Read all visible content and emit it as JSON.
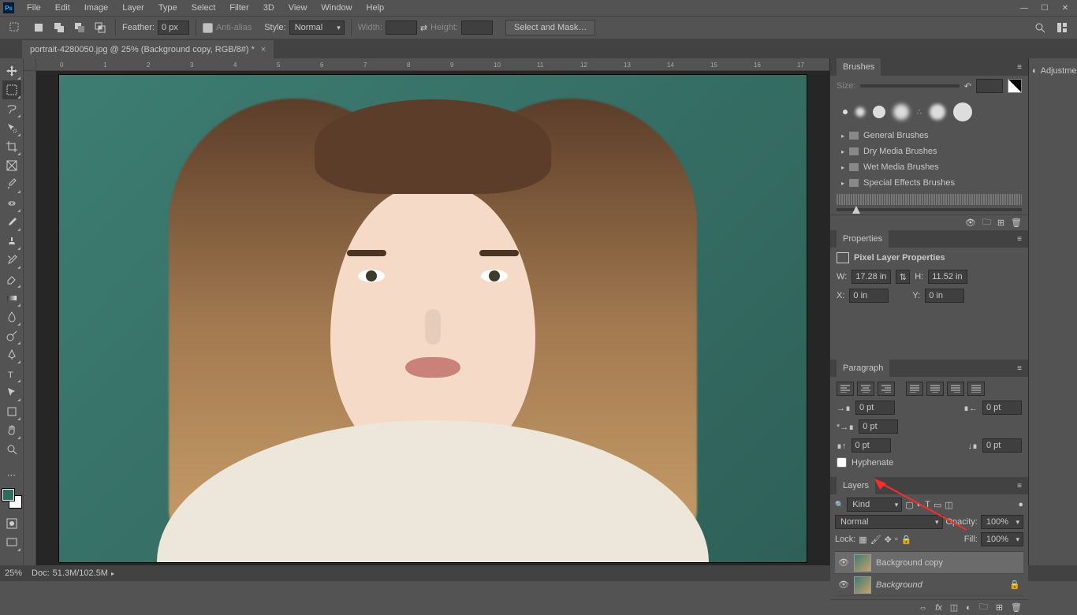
{
  "app": {
    "logo": "Ps"
  },
  "menu": [
    "File",
    "Edit",
    "Image",
    "Layer",
    "Type",
    "Select",
    "Filter",
    "3D",
    "View",
    "Window",
    "Help"
  ],
  "options": {
    "feather_label": "Feather:",
    "feather_value": "0 px",
    "antialias": "Anti-alias",
    "style_label": "Style:",
    "style_value": "Normal",
    "width_label": "Width:",
    "height_label": "Height:",
    "select_mask": "Select and Mask…"
  },
  "tab": {
    "title": "portrait-4280050.jpg @ 25% (Background copy, RGB/8#) *"
  },
  "ruler_marks": [
    "0",
    "1",
    "2",
    "3",
    "4",
    "5",
    "6",
    "7",
    "8",
    "9",
    "10",
    "11",
    "12",
    "13",
    "14",
    "15",
    "16",
    "17"
  ],
  "side_panel": {
    "adjustments": "Adjustments"
  },
  "brushes": {
    "title": "Brushes",
    "size_label": "Size:",
    "folders": [
      "General Brushes",
      "Dry Media Brushes",
      "Wet Media Brushes",
      "Special Effects Brushes"
    ]
  },
  "properties": {
    "title": "Properties",
    "subtitle": "Pixel Layer Properties",
    "w_label": "W:",
    "w_value": "17.28 in",
    "h_label": "H:",
    "h_value": "11.52 in",
    "x_label": "X:",
    "x_value": "0 in",
    "y_label": "Y:",
    "y_value": "0 in"
  },
  "paragraph": {
    "title": "Paragraph",
    "indent_left": "0 pt",
    "indent_right": "0 pt",
    "first_line": "0 pt",
    "space_before": "0 pt",
    "space_after": "0 pt",
    "hyphenate": "Hyphenate"
  },
  "layers": {
    "title": "Layers",
    "kind_label": "Kind",
    "blend_mode": "Normal",
    "opacity_label": "Opacity:",
    "opacity_value": "100%",
    "lock_label": "Lock:",
    "fill_label": "Fill:",
    "fill_value": "100%",
    "items": [
      {
        "name": "Background copy",
        "selected": true,
        "locked": false
      },
      {
        "name": "Background",
        "selected": false,
        "locked": true
      }
    ]
  },
  "status": {
    "zoom": "25%",
    "doc_label": "Doc:",
    "doc_value": "51.3M/102.5M"
  }
}
